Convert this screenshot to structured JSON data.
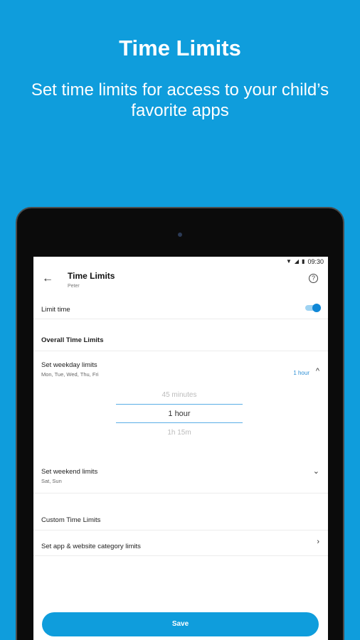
{
  "promo": {
    "title": "Time Limits",
    "subtitle": "Set time limits for access to your child’s favorite apps"
  },
  "status_bar": {
    "time": "09:30",
    "icons": [
      "wifi-icon",
      "signal-icon",
      "battery-icon"
    ]
  },
  "app_bar": {
    "title": "Time Limits",
    "subtitle": "Peter",
    "back_icon": "arrow-back-icon",
    "help_icon": "help-icon"
  },
  "limit_time": {
    "label": "Limit time",
    "enabled": true
  },
  "overall": {
    "title": "Overall Time Limits"
  },
  "weekday": {
    "label": "Set weekday limits",
    "days": "Mon, Tue, Wed, Thu, Fri",
    "value": "1 hour"
  },
  "picker": {
    "above": "45 minutes",
    "selected": "1 hour",
    "below": "1h 15m"
  },
  "weekend": {
    "label": "Set weekend limits",
    "days": "Sat, Sun"
  },
  "custom": {
    "title": "Custom Time Limits",
    "category_label": "Set app & website category limits"
  },
  "save": {
    "label": "Save"
  },
  "colors": {
    "brand": "#0f9ddc",
    "accent": "#2d8fd5"
  }
}
